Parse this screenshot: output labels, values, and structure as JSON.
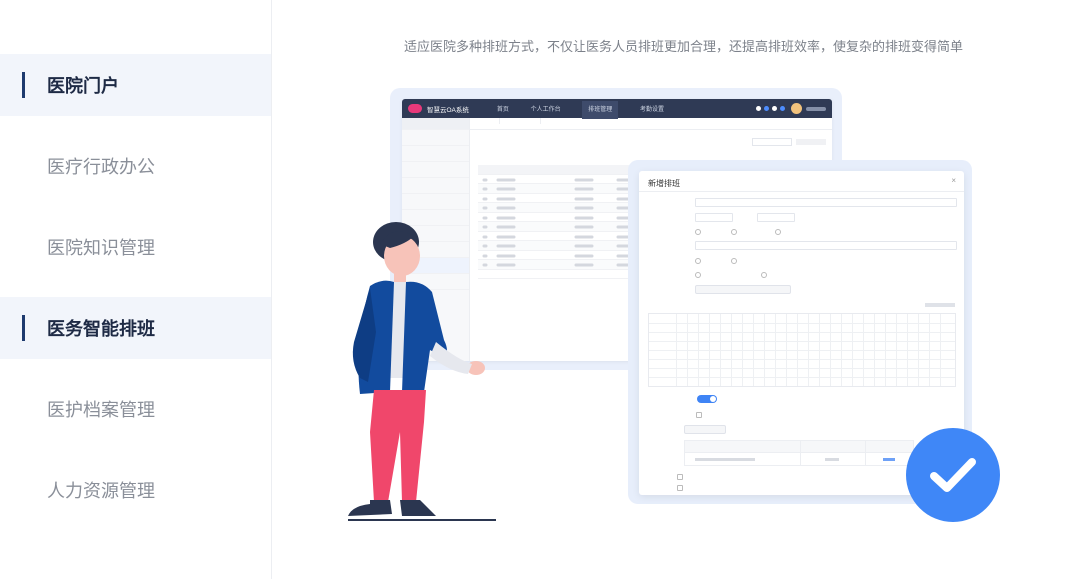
{
  "nav": {
    "items": [
      {
        "label": "医院门户",
        "active": true
      },
      {
        "label": "医疗行政办公",
        "active": false
      },
      {
        "label": "医院知识管理",
        "active": false
      },
      {
        "label": "医务智能排班",
        "active": true
      },
      {
        "label": "医护档案管理",
        "active": false
      },
      {
        "label": "人力资源管理",
        "active": false
      }
    ]
  },
  "hero": {
    "subtitle": "适应医院多种排班方式，不仅让医务人员排班更加合理，还提高排班效率，使复杂的排班变得简单"
  },
  "mock_app": {
    "brand": "智慧云OA系统",
    "menu": [
      "首页",
      "个人工作台",
      "排班管理",
      "考勤设置"
    ],
    "dialog_title": "新增排班"
  },
  "colors": {
    "accent": "#3f87f7",
    "nav_active_bg": "#f2f5fb",
    "nav_active_text": "#1e2a45",
    "nav_text": "#8a8f99",
    "topbar": "#2f3a55"
  },
  "icons": {
    "badge": "check-icon"
  }
}
